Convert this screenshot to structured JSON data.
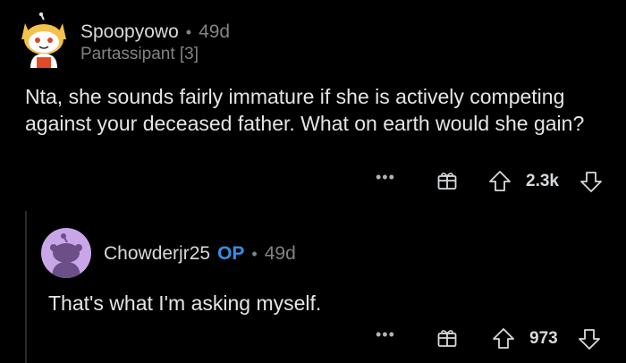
{
  "comments": [
    {
      "username": "Spoopyowo",
      "separator": "•",
      "age": "49d",
      "flair": "Partassipant [3]",
      "body": "Nta, she sounds fairly immature if she is actively competing against your deceased father. What on earth would she gain?",
      "more": "•••",
      "score": "2.3k"
    },
    {
      "username": "Chowderjr25",
      "op_badge": "OP",
      "separator": "•",
      "age": "49d",
      "body": "That's what I'm asking myself.",
      "more": "•••",
      "score": "973"
    }
  ],
  "colors": {
    "background": "#000000",
    "op": "#3b8de0",
    "meta": "#818384",
    "avatar_purple": "#c9a6e8"
  }
}
